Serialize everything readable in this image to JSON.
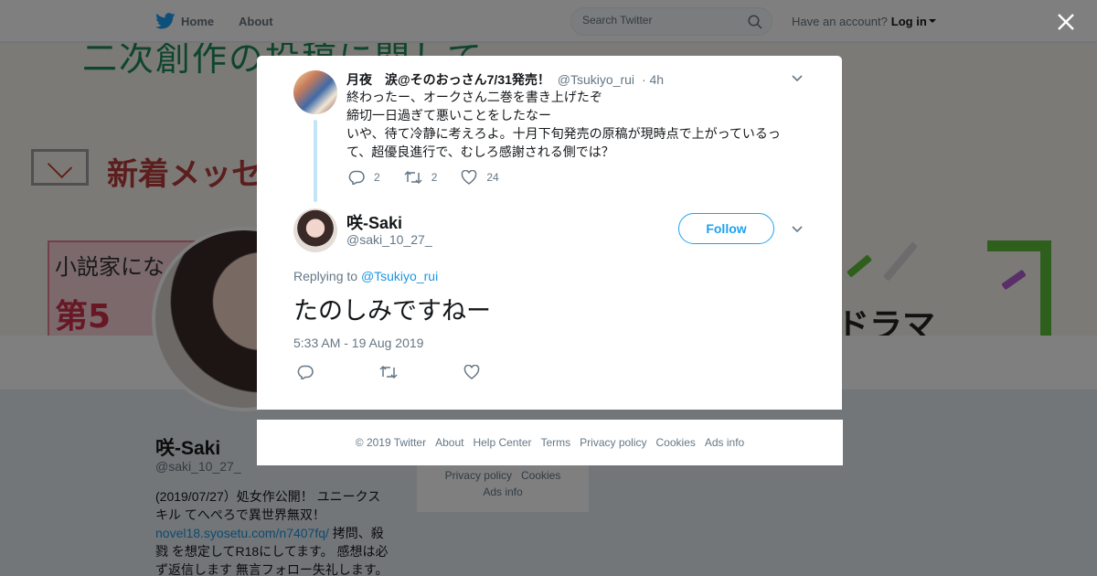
{
  "nav": {
    "home_label": "Home",
    "about_label": "About",
    "search_placeholder": "Search Twitter",
    "account_text": "Have an account?",
    "login_label": "Log in"
  },
  "banner": {
    "title": "二次創作の投稿に関して",
    "message": "新着メッセ",
    "pink_text": "小説家にな",
    "pink_big": "第5",
    "right_text": "ドラマ"
  },
  "profile": {
    "name": "咲-Saki",
    "handle": "@saki_10_27_",
    "bio_1": "(2019/07/27）処女作公開！ ユニークス キル てへぺろで異世界無双！",
    "bio_link": "novel18.syosetu.com/n7407fq/",
    "bio_2": " 拷問、殺 戮 を想定してR18にしてます。 感想は必 ず返信します 無言フォロー失礼します。",
    "footer_line1_a": "Privacy policy",
    "footer_line1_b": "Cookies",
    "footer_line2": "Ads info"
  },
  "quoted_tweet": {
    "name": "月夜　涙@そのおっさん7/31発売！",
    "handle": "@Tsukiyo_rui",
    "time": "· 4h",
    "text_lines": [
      "終わったー、オークさん二巻を書き上げたぞ",
      "締切一日過ぎて悪いことをしたなー",
      "いや、待て冷静に考えろよ。十月下旬発売の原稿が現時点で上がっているっ",
      "て、超優良進行で、むしろ感謝される側では？"
    ],
    "reply_count": "2",
    "retweet_count": "2",
    "like_count": "24"
  },
  "main_tweet": {
    "name": "咲-Saki",
    "handle": "@saki_10_27_",
    "follow_label": "Follow",
    "replying_prefix": "Replying to",
    "replying_to": "@Tsukiyo_rui",
    "text": "たのしみですねー",
    "timestamp": "5:33 AM - 19 Aug 2019"
  },
  "footer": {
    "items": [
      "© 2019 Twitter",
      "About",
      "Help Center",
      "Terms",
      "Privacy policy",
      "Cookies",
      "Ads info"
    ]
  },
  "colors": {
    "twitter_blue": "#1da1f2",
    "link_blue": "#1b95e0",
    "text_gray": "#657786"
  }
}
